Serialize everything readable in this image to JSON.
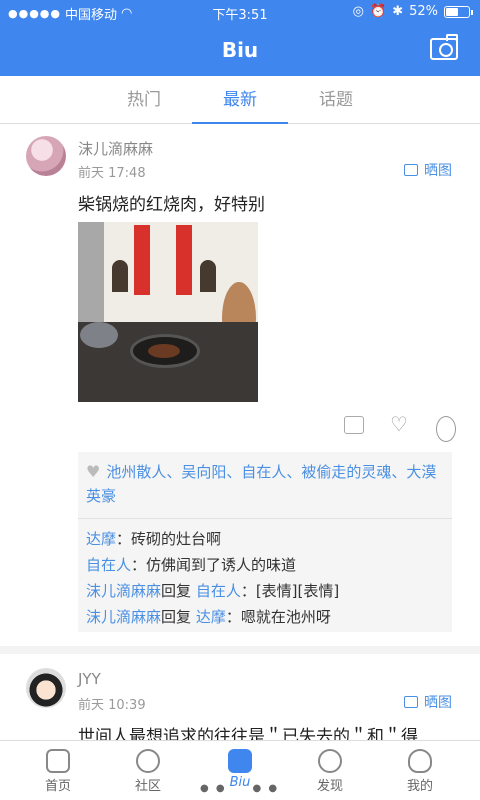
{
  "status": {
    "carrier": "中国移动",
    "time": "下午3:51",
    "battery": "52%"
  },
  "navbar": {
    "title": "Biu",
    "camera_icon": "camera-icon"
  },
  "tabs": [
    {
      "label": "热门"
    },
    {
      "label": "最新"
    },
    {
      "label": "话题"
    }
  ],
  "post1": {
    "username": "沫儿滴麻麻",
    "time": "前天 17:48",
    "share_label": "晒图",
    "text": "柴锅烧的红烧肉，好特别",
    "likers": "池州散人、吴向阳、自在人、被偷走的灵魂、大漠英豪",
    "comments": [
      {
        "name": "达摩",
        "text": "：砖砌的灶台啊"
      },
      {
        "name": "自在人",
        "text": "：仿佛闻到了诱人的味道"
      },
      {
        "name": "沫儿滴麻麻",
        "reply": "回复",
        "to": "自在人",
        "text": "：[表情][表情]"
      },
      {
        "name": "沫儿滴麻麻",
        "reply": "回复",
        "to": "达摩",
        "text": "：嗯就在池州呀"
      }
    ]
  },
  "post2": {
    "username": "JYY",
    "time": "前天 10:39",
    "share_label": "晒图",
    "text": "世间人最想追求的往往是＂已失去的＂和＂得"
  },
  "bottom_nav": [
    {
      "label": "首页"
    },
    {
      "label": "社区"
    },
    {
      "label": "Biu"
    },
    {
      "label": "发现"
    },
    {
      "label": "我的"
    }
  ]
}
